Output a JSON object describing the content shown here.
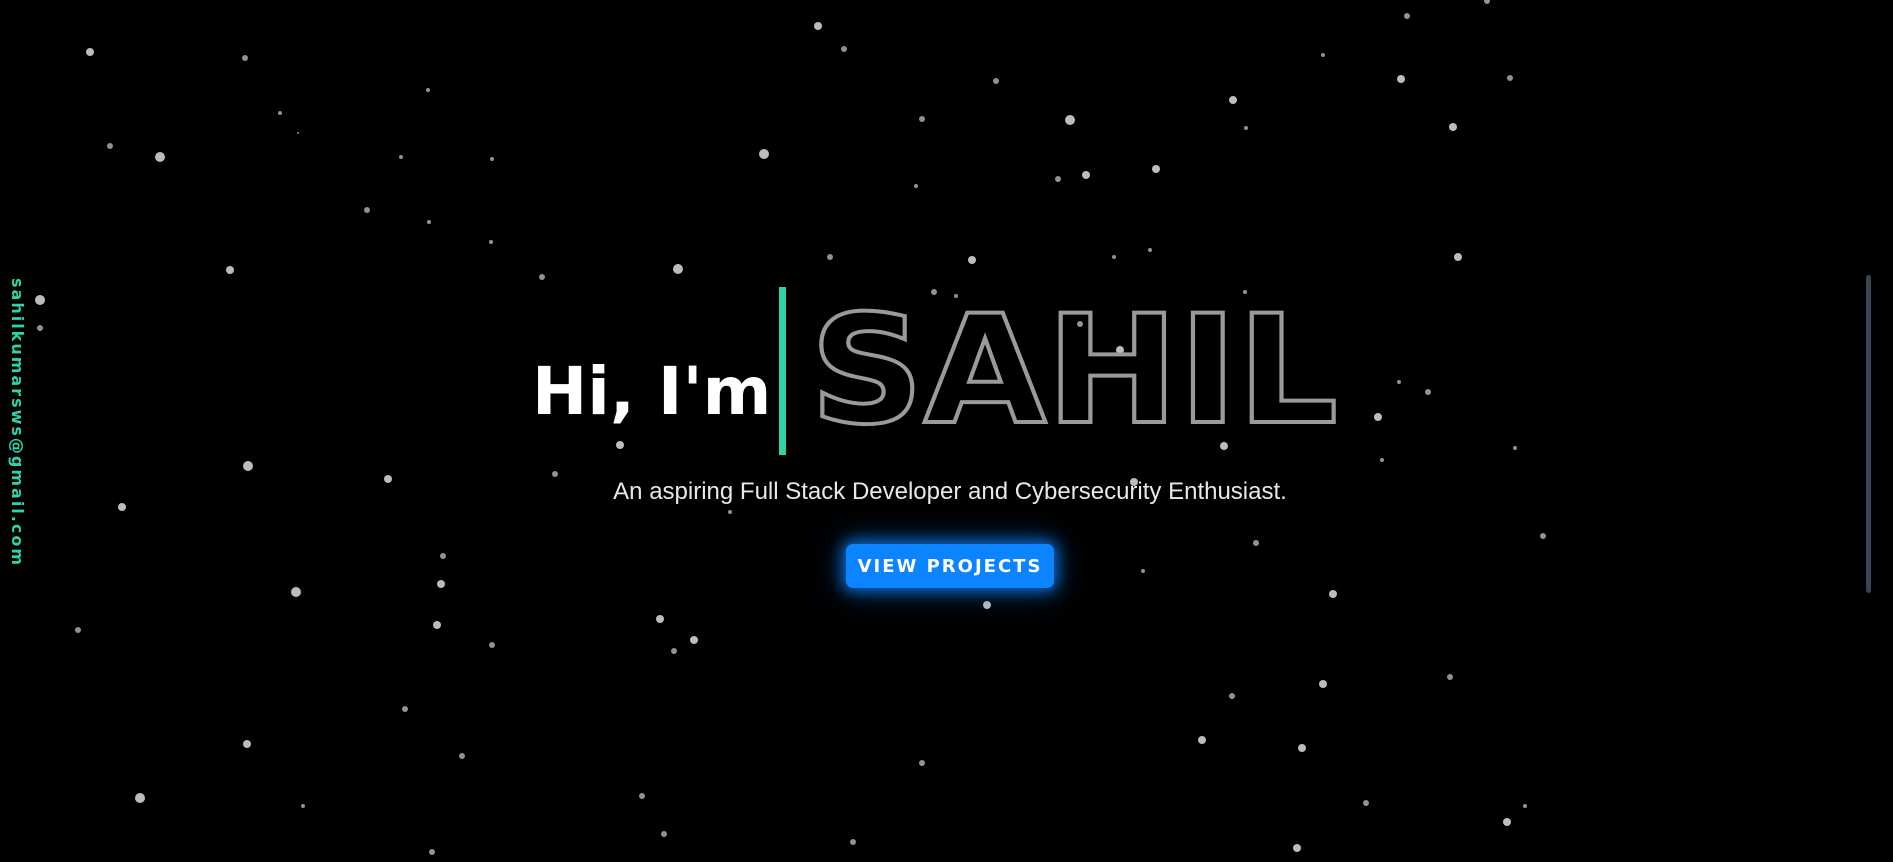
{
  "sidebar": {
    "email": "sahilkumarsws@gmail.com"
  },
  "hero": {
    "greeting": "Hi, I'm",
    "name": "SAHIL",
    "tagline": "An aspiring Full Stack Developer and Cybersecurity Enthusiast.",
    "cta_label": "VIEW PROJECTS"
  },
  "colors": {
    "background": "#000000",
    "accent_teal": "#2dd4a8",
    "button_blue": "#0d84ff",
    "outline_gray": "#9a9a9a",
    "star": "#d0d0d0"
  }
}
